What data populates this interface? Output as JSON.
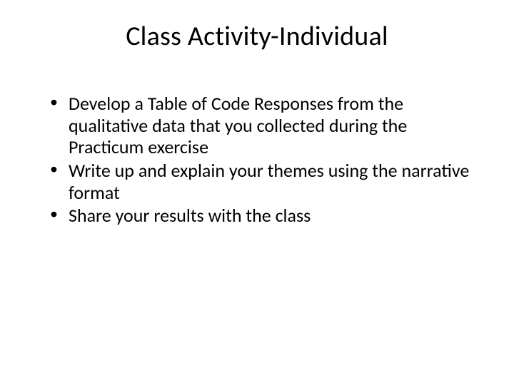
{
  "slide": {
    "title": "Class Activity-Individual",
    "bullets": [
      "Develop a Table of Code Responses from the qualitative data that you collected during the Practicum exercise",
      "Write up and explain your themes using the narrative format",
      "Share your results with the class"
    ]
  }
}
